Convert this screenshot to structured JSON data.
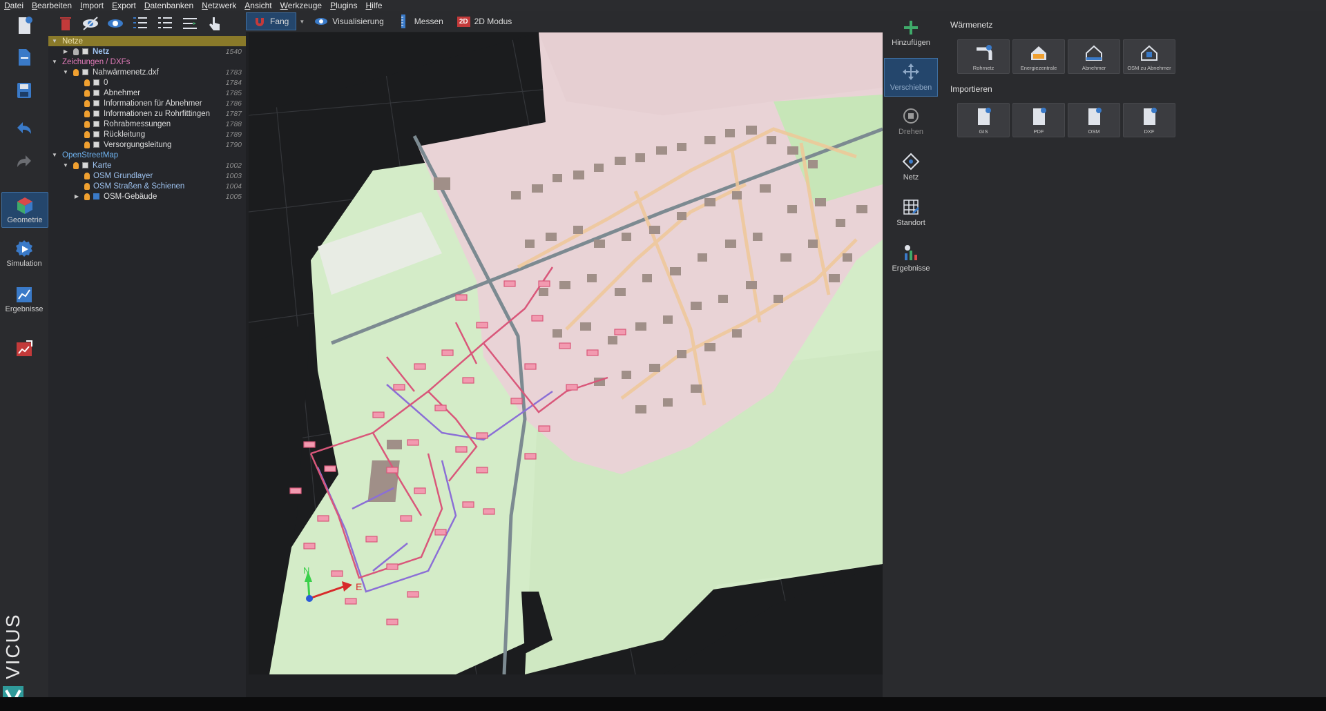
{
  "menu": [
    "Datei",
    "Bearbeiten",
    "Import",
    "Export",
    "Datenbanken",
    "Netzwerk",
    "Ansicht",
    "Werkzeuge",
    "Plugins",
    "Hilfe"
  ],
  "sidebar": {
    "geometry": "Geometrie",
    "simulation": "Simulation",
    "results": "Ergebnisse",
    "brand": "VICUS"
  },
  "tree": [
    {
      "label": "Netze",
      "id": "",
      "level": 0,
      "arrow": "▼",
      "bulb": false,
      "box": false,
      "style": "sel"
    },
    {
      "label": "Netz",
      "id": "1540",
      "level": 1,
      "arrow": "▶",
      "bulb": "dim",
      "box": true,
      "style": "bold-blue"
    },
    {
      "label": "Zeichungen / DXFs",
      "id": "",
      "level": 0,
      "arrow": "▼",
      "bulb": false,
      "box": false,
      "style": "pink"
    },
    {
      "label": "Nahwärmenetz.dxf",
      "id": "1783",
      "level": 1,
      "arrow": "▼",
      "bulb": "on",
      "box": true,
      "style": ""
    },
    {
      "label": "0",
      "id": "1784",
      "level": 2,
      "arrow": "",
      "bulb": "on",
      "box": true,
      "style": ""
    },
    {
      "label": "Abnehmer",
      "id": "1785",
      "level": 2,
      "arrow": "",
      "bulb": "on",
      "box": true,
      "style": ""
    },
    {
      "label": "Informationen für Abnehmer",
      "id": "1786",
      "level": 2,
      "arrow": "",
      "bulb": "on",
      "box": true,
      "style": ""
    },
    {
      "label": "Informationen zu Rohrfittingen",
      "id": "1787",
      "level": 2,
      "arrow": "",
      "bulb": "on",
      "box": true,
      "style": ""
    },
    {
      "label": "Rohrabmessungen",
      "id": "1788",
      "level": 2,
      "arrow": "",
      "bulb": "on",
      "box": true,
      "style": ""
    },
    {
      "label": "Rückleitung",
      "id": "1789",
      "level": 2,
      "arrow": "",
      "bulb": "on",
      "box": true,
      "style": ""
    },
    {
      "label": "Versorgungsleitung",
      "id": "1790",
      "level": 2,
      "arrow": "",
      "bulb": "on",
      "box": true,
      "style": ""
    },
    {
      "label": "OpenStreetMap",
      "id": "",
      "level": 0,
      "arrow": "▼",
      "bulb": false,
      "box": false,
      "style": "blue"
    },
    {
      "label": "Karte",
      "id": "1002",
      "level": 1,
      "arrow": "▼",
      "bulb": "on",
      "box": true,
      "style": "lblue"
    },
    {
      "label": "OSM Grundlayer",
      "id": "1003",
      "level": 2,
      "arrow": "",
      "bulb": "on",
      "box": false,
      "style": "lblue"
    },
    {
      "label": "OSM Straßen & Schienen",
      "id": "1004",
      "level": 2,
      "arrow": "",
      "bulb": "on",
      "box": false,
      "style": "lblue"
    },
    {
      "label": "OSM-Gebäude",
      "id": "1005",
      "level": 2,
      "arrow": "▶",
      "bulb": "on",
      "box": true,
      "style": "layer"
    }
  ],
  "viewport_toolbar": {
    "snap": "Fang",
    "visualization": "Visualisierung",
    "measure": "Messen",
    "mode_badge": "2D",
    "mode": "2D Modus"
  },
  "axis": {
    "north": "N",
    "east": "E"
  },
  "commands": {
    "add": "Hinzufügen",
    "move": "Verschieben",
    "rotate": "Drehen",
    "network": "Netz",
    "location": "Standort",
    "results": "Ergebnisse"
  },
  "panel": {
    "section1": "Wärmenetz",
    "tiles1": [
      "Rohrnetz",
      "Energiezentrale",
      "Abnehmer",
      "OSM zu Abnehmer"
    ],
    "section2": "Importieren",
    "tiles2": [
      "GIS",
      "PDF",
      "OSM",
      "DXF"
    ]
  },
  "colors": {
    "accent": "#24466c",
    "background": "#1f2023",
    "residential": "#e9d3d6",
    "greenland": "#d4ecc8",
    "pipe_supply": "#d9577a",
    "pipe_return": "#8b6fd6",
    "buildings": "#a08f88",
    "roads": "#f0c898"
  }
}
